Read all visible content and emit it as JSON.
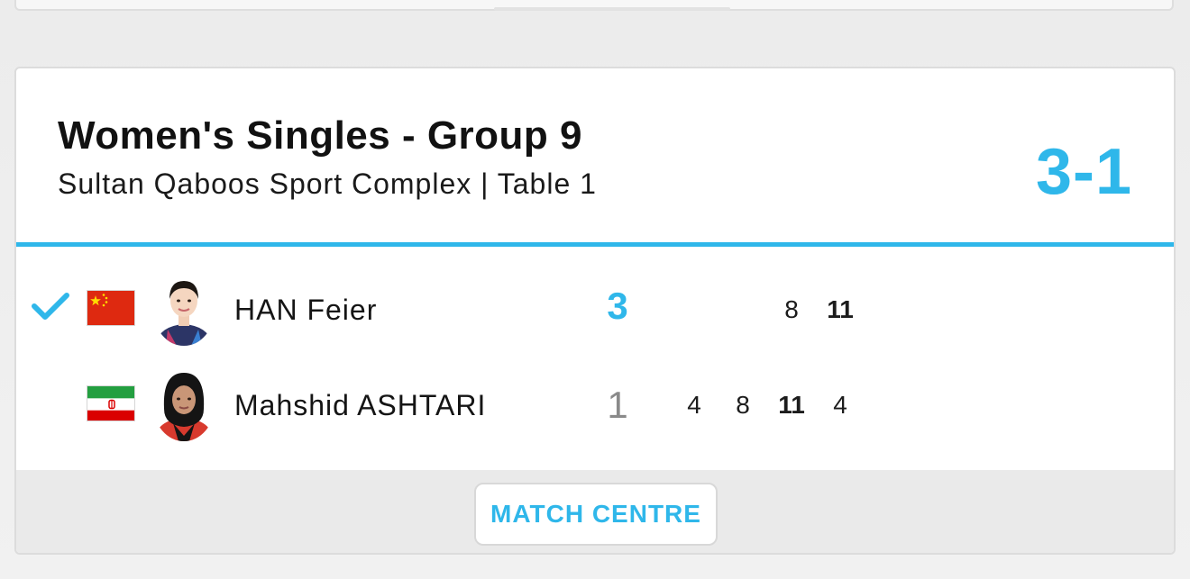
{
  "match": {
    "title": "Women's Singles - Group 9",
    "venue": "Sultan Qaboos Sport Complex | Table 1",
    "final_score": "3-1"
  },
  "players": [
    {
      "name": "HAN Feier",
      "country_flag": "china-flag",
      "winner": true,
      "games_won": "3",
      "game_scores": [
        "8",
        "11"
      ]
    },
    {
      "name": "Mahshid ASHTARI",
      "country_flag": "iran-flag",
      "winner": false,
      "games_won": "1",
      "game_scores": [
        "4",
        "8",
        "11",
        "4"
      ]
    }
  ],
  "footer": {
    "match_centre_label": "MATCH CENTRE"
  },
  "colors": {
    "accent": "#2fb7ea",
    "card_bg": "#ffffff",
    "footer_bg": "#eaeaea"
  }
}
